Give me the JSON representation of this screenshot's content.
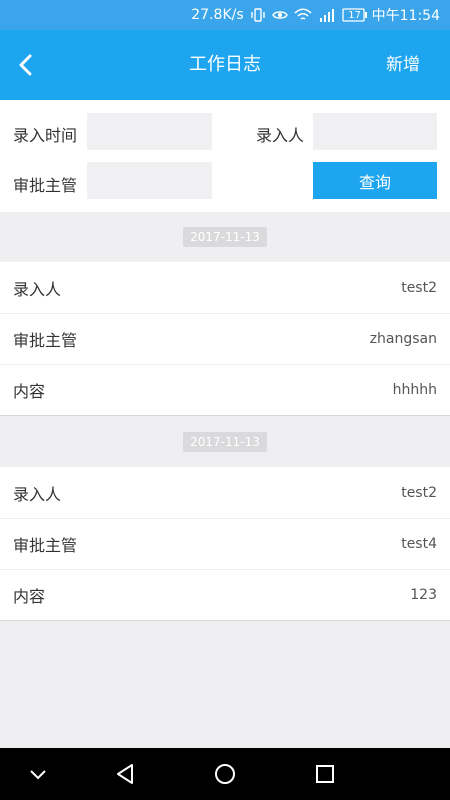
{
  "status": {
    "speed": "27.8K/s",
    "battery": "17",
    "time": "中午11:54"
  },
  "appbar": {
    "title": "工作日志",
    "add_label": "新增"
  },
  "filter": {
    "entry_time_label": "录入时间",
    "entry_person_label": "录入人",
    "supervisor_label": "审批主管",
    "query_label": "查询",
    "entry_time_value": "",
    "entry_person_value": "",
    "supervisor_value": ""
  },
  "records": [
    {
      "date": "2017-11-13",
      "rows": [
        {
          "key": "录入人",
          "value": "test2"
        },
        {
          "key": "审批主管",
          "value": "zhangsan"
        },
        {
          "key": "内容",
          "value": "hhhhh"
        }
      ]
    },
    {
      "date": "2017-11-13",
      "rows": [
        {
          "key": "录入人",
          "value": "test2"
        },
        {
          "key": "审批主管",
          "value": "test4"
        },
        {
          "key": "内容",
          "value": "123"
        }
      ]
    }
  ],
  "colors": {
    "primary": "#1ea5f0",
    "statusbar": "#3aa5eb",
    "background": "#efeff1"
  }
}
